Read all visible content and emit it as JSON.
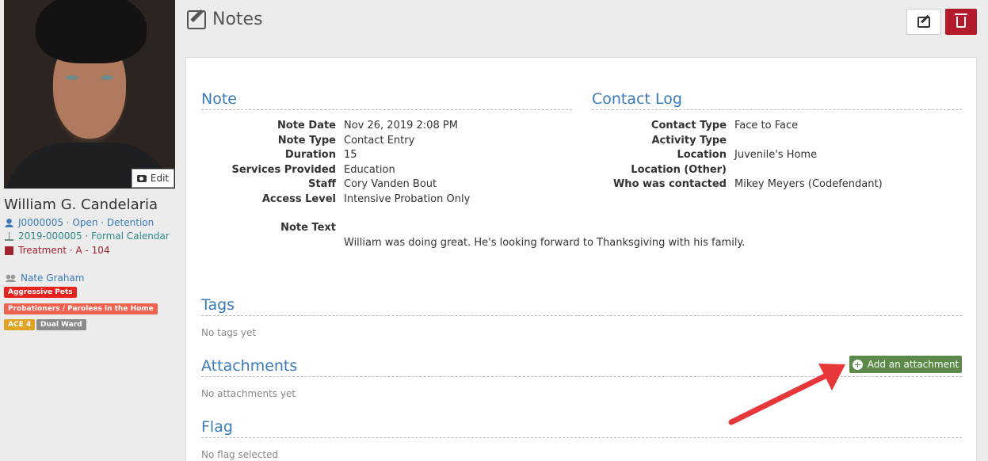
{
  "profile": {
    "edit_label": "Edit",
    "name": "William G. Candelaria",
    "case_line": "J0000005 · Open · Detention",
    "docket_line": "2019-000005 · Formal Calendar",
    "facility_line": "Treatment · A - 104",
    "officer": "Nate Graham",
    "badges": [
      "Aggressive Pets",
      "Probationers / Parolees in the Home",
      "ACE 4",
      "Dual Ward"
    ]
  },
  "header": {
    "title": "Notes"
  },
  "note": {
    "title": "Note",
    "fields": [
      {
        "label": "Note Date",
        "value": "Nov 26, 2019 2:08 PM"
      },
      {
        "label": "Note Type",
        "value": "Contact Entry"
      },
      {
        "label": "Duration",
        "value": "15"
      },
      {
        "label": "Services Provided",
        "value": "Education"
      },
      {
        "label": "Staff",
        "value": "Cory Vanden Bout"
      },
      {
        "label": "Access Level",
        "value": "Intensive Probation Only"
      }
    ],
    "text_label": "Note Text",
    "text_value": "William was doing great. He's looking forward to Thanksgiving with his family."
  },
  "contact_log": {
    "title": "Contact Log",
    "fields": [
      {
        "label": "Contact Type",
        "value": "Face to Face"
      },
      {
        "label": "Activity Type",
        "value": ""
      },
      {
        "label": "Location",
        "value": "Juvenile's Home"
      },
      {
        "label": "Location (Other)",
        "value": ""
      },
      {
        "label": "Who was contacted",
        "value": "Mikey Meyers (Codefendant)"
      }
    ]
  },
  "tags": {
    "title": "Tags",
    "empty": "No tags yet"
  },
  "attachments": {
    "title": "Attachments",
    "empty": "No attachments yet",
    "add_label": "Add an attachment"
  },
  "flag": {
    "title": "Flag",
    "empty": "No flag selected"
  },
  "colors": {
    "accent": "#3a7ab8",
    "danger": "#b31b2b",
    "success": "#5c8a4a",
    "arrow": "#e8373a"
  },
  "icons": [
    "camera-icon",
    "user-icon",
    "scale-icon",
    "building-icon",
    "users-icon",
    "pencil-square-icon",
    "edit-icon",
    "trash-icon",
    "plus-circle-icon"
  ]
}
